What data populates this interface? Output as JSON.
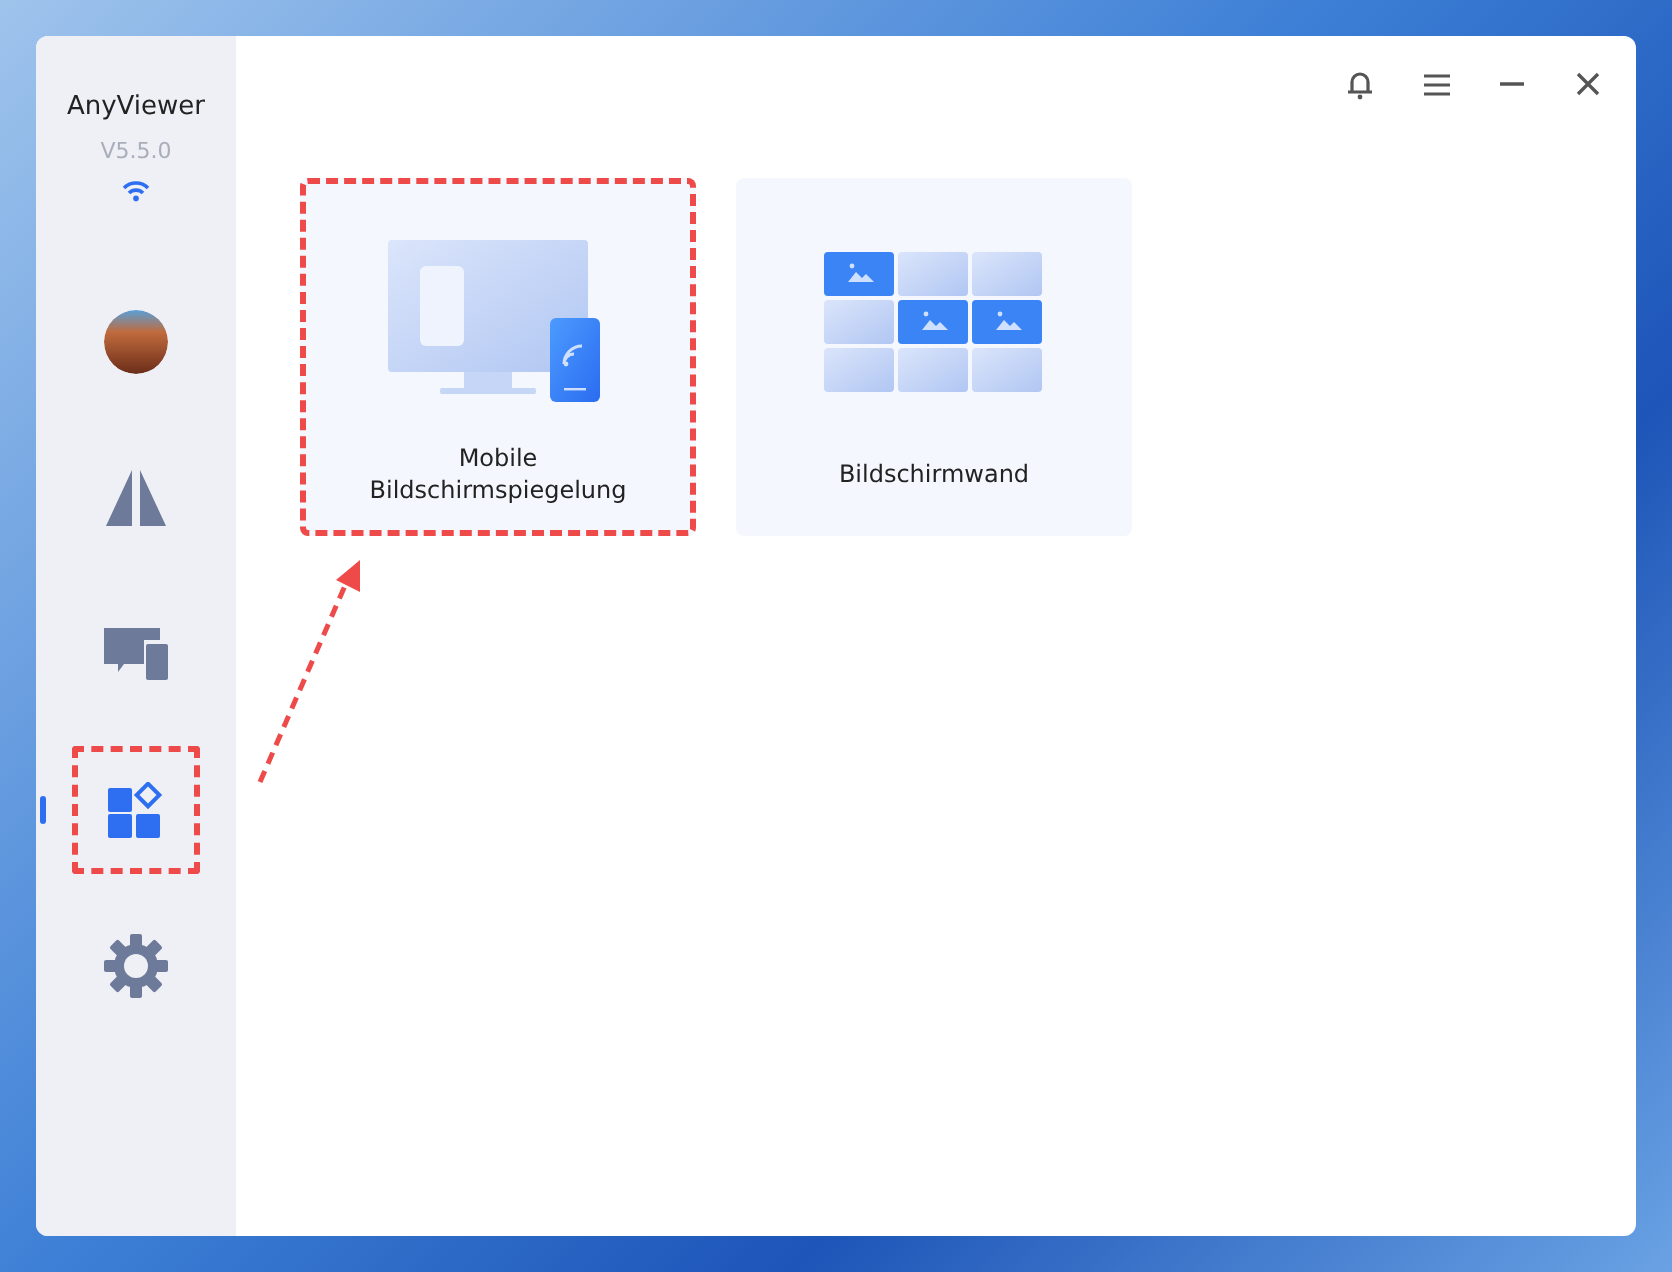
{
  "app": {
    "name": "AnyViewer",
    "version": "V5.5.0"
  },
  "nav": [
    {
      "kind": "avatar",
      "selected": false,
      "highlighted": false
    },
    {
      "kind": "mirror",
      "selected": false,
      "highlighted": false
    },
    {
      "kind": "devices",
      "selected": false,
      "highlighted": false
    },
    {
      "kind": "apps",
      "selected": true,
      "highlighted": true
    },
    {
      "kind": "settings",
      "selected": false,
      "highlighted": false
    }
  ],
  "cards": [
    {
      "kind": "mirroring",
      "label": "Mobile\nBildschirmspiegelung",
      "highlighted": true
    },
    {
      "kind": "wall",
      "label": "Bildschirmwand",
      "highlighted": false
    }
  ],
  "annotation_arrow": true
}
